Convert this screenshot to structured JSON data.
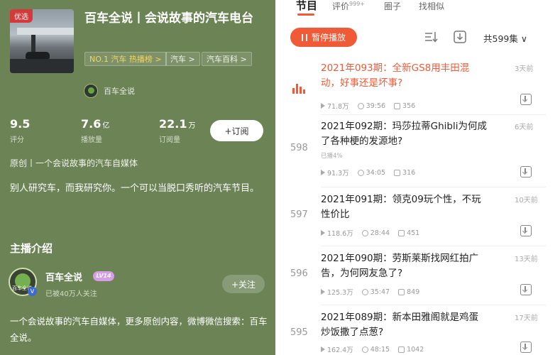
{
  "album": {
    "badge": "优选",
    "title": "百车全说丨会说故事的汽车电台",
    "tags": [
      "NO.1 汽车 热播榜 >",
      "汽车 >",
      "汽车百科 >"
    ],
    "author_name": "百车全说",
    "stats": [
      {
        "num": "9.5",
        "unit": "",
        "label": "评分"
      },
      {
        "num": "7.6",
        "unit": "亿",
        "label": "播放量"
      },
      {
        "num": "22.1",
        "unit": "万",
        "label": "订阅量"
      }
    ],
    "subscribe_label": "+订阅",
    "intro_line": "原创丨一个会说故事的汽车自媒体",
    "description": "别人研究车，而我研究你。一个可以当脱口秀听的汽车节目。"
  },
  "host": {
    "section_title": "主播介绍",
    "name": "百车全说",
    "level": "LV14",
    "avatar_text": "百车全说",
    "followers": "已被40万人关注",
    "follow_label": "+关注",
    "bio": "一个会说故事的汽车自媒体，更多原创内容，微博微信搜索：百车全说。"
  },
  "tabs": [
    {
      "label": "节目",
      "badge": ""
    },
    {
      "label": "评价",
      "badge": "999+"
    },
    {
      "label": "圈子",
      "badge": ""
    },
    {
      "label": "找相似",
      "badge": ""
    }
  ],
  "toolbar": {
    "pause_label": "暂停播放",
    "total": "共599集 ∨"
  },
  "episodes": [
    {
      "index": "",
      "title": "2021年093期：全新GS8用丰田混动，好事还是坏事?",
      "date": "3天前",
      "progress": "",
      "plays": "71.8万",
      "duration": "39:56",
      "comments": "356",
      "playing": true
    },
    {
      "index": "598",
      "title": "2021年092期：玛莎拉蒂Ghibli为何成了各种梗的发源地?",
      "date": "6天前",
      "progress": "已播4%",
      "plays": "91.3万",
      "duration": "34:05",
      "comments": "316",
      "playing": false
    },
    {
      "index": "597",
      "title": "2021年091期：领克09玩个性，不玩性价比",
      "date": "10天前",
      "progress": "",
      "plays": "118.6万",
      "duration": "28:44",
      "comments": "451",
      "playing": false
    },
    {
      "index": "596",
      "title": "2021年090期：劳斯莱斯找网红拍广告，为何网友急了?",
      "date": "13天前",
      "progress": "",
      "plays": "125.3万",
      "duration": "35:47",
      "comments": "849",
      "playing": false
    },
    {
      "index": "595",
      "title": "2021年089期：新本田雅阁就是鸡蛋炒饭撒了点葱?",
      "date": "17天前",
      "progress": "",
      "plays": "162.4万",
      "duration": "48:15",
      "comments": "1042",
      "playing": false
    }
  ],
  "colors": {
    "left_bg": "#6b8355",
    "accent": "#f05a37"
  }
}
